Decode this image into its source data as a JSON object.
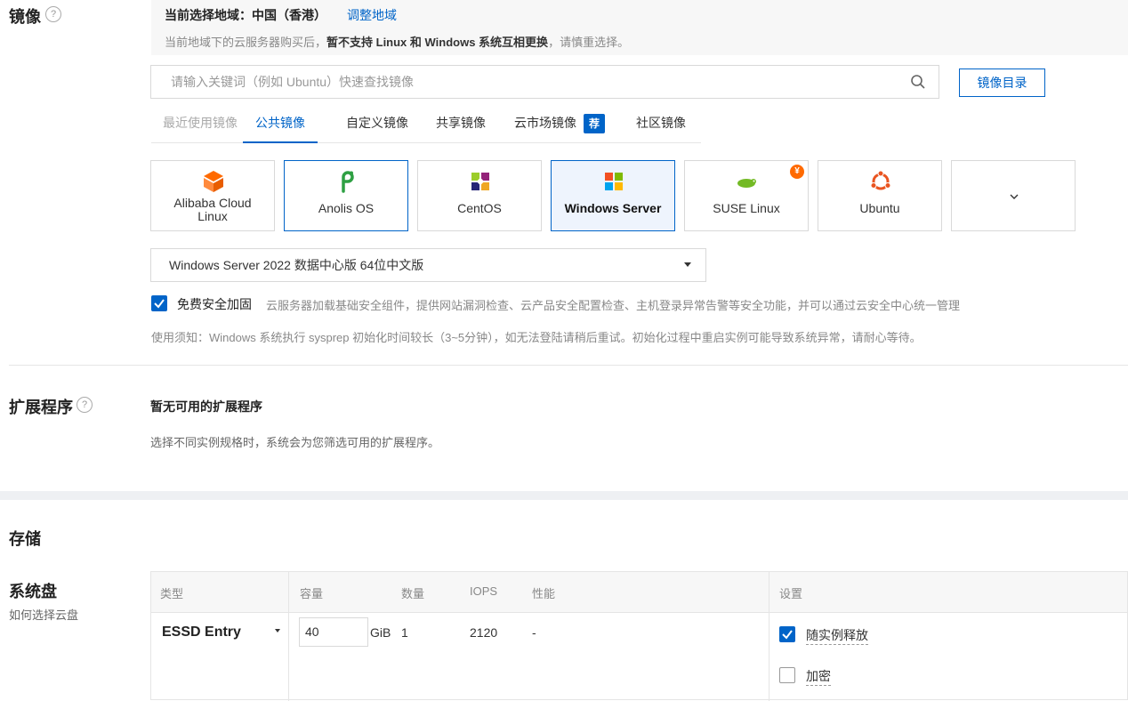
{
  "image": {
    "title": "镜像",
    "help_icon": "?",
    "region": {
      "label": "当前选择地域：中国（香港）",
      "change_link": "调整地域",
      "note_prefix": "当前地域下的云服务器购买后，",
      "note_bold": "暂不支持 Linux 和 Windows 系统互相更换",
      "note_suffix": "，请慎重选择。"
    },
    "search": {
      "placeholder": "请输入关键词（例如 Ubuntu）快速查找镜像"
    },
    "catalog_button": "镜像目录",
    "tabs": [
      {
        "label": "最近使用镜像",
        "state": "disabled"
      },
      {
        "label": "公共镜像",
        "state": "active"
      },
      {
        "label": "自定义镜像",
        "state": "normal"
      },
      {
        "label": "共享镜像",
        "state": "normal"
      },
      {
        "label": "云市场镜像",
        "state": "normal",
        "tag": "荐"
      },
      {
        "label": "社区镜像",
        "state": "normal"
      }
    ],
    "os_cards": [
      {
        "label": "Alibaba Cloud Linux",
        "icon": "alibaba-cloud-linux-icon"
      },
      {
        "label": "Anolis OS",
        "icon": "anolis-icon"
      },
      {
        "label": "CentOS",
        "icon": "centos-icon"
      },
      {
        "label": "Windows Server",
        "icon": "windows-icon",
        "selected": true
      },
      {
        "label": "SUSE Linux",
        "icon": "suse-icon",
        "badge": "¥"
      },
      {
        "label": "Ubuntu",
        "icon": "ubuntu-icon"
      },
      {
        "label": "",
        "icon": "chevron-down-icon"
      }
    ],
    "version_selected": "Windows Server 2022 数据中心版 64位中文版",
    "security_hardening": {
      "checked": true,
      "label": "免费安全加固",
      "description": "云服务器加载基础安全组件，提供网站漏洞检查、云产品安全配置检查、主机登录异常告警等安全功能，并可以通过云安全中心统一管理"
    },
    "usage_note": "使用须知：Windows 系统执行 sysprep 初始化时间较长（3~5分钟），如无法登陆请稍后重试。初始化过程中重启实例可能导致系统异常，请耐心等待。"
  },
  "extensions": {
    "title": "扩展程序",
    "help_icon": "?",
    "empty_title": "暂无可用的扩展程序",
    "empty_desc": "选择不同实例规格时，系统会为您筛选可用的扩展程序。"
  },
  "storage": {
    "title": "存储",
    "system_disk": {
      "title": "系统盘",
      "help_link": "如何选择云盘",
      "columns": [
        "类型",
        "容量",
        "数量",
        "IOPS",
        "性能",
        "设置"
      ],
      "row": {
        "type": "ESSD Entry",
        "capacity": "40",
        "unit": "GiB",
        "quantity": "1",
        "iops": "2120",
        "performance": "-",
        "release_with_instance": {
          "checked": true,
          "label": "随实例释放"
        },
        "encryption": {
          "checked": false,
          "label": "加密"
        }
      }
    }
  },
  "colors": {
    "accent": "#0064c8",
    "warning_badge": "#ff6a00",
    "band": "#eef0f3"
  }
}
